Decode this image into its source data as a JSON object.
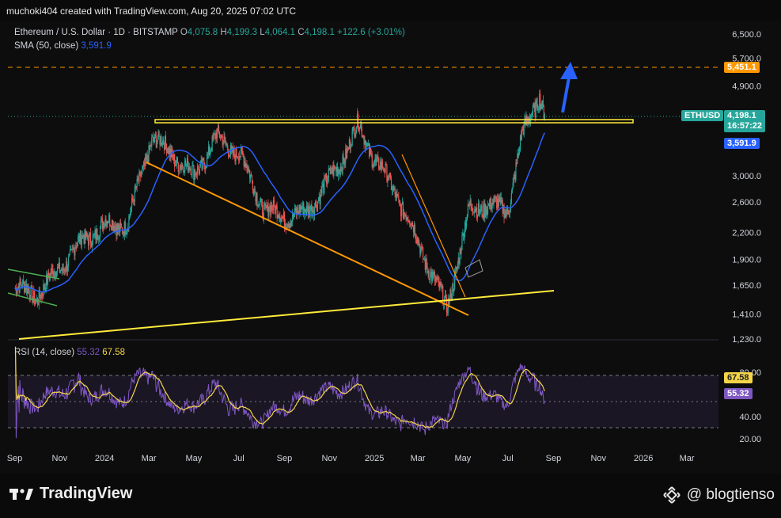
{
  "header": {
    "text": "muchoki404 created with TradingView.com, Aug 20, 2025 07:02 UTC"
  },
  "legend": {
    "symbol": "Ethereum / U.S. Dollar · 1D · BITSTAMP",
    "o_label": "O",
    "o_value": "4,075.8",
    "h_label": "H",
    "h_value": "4,199.3",
    "l_label": "L",
    "l_value": "4,064.1",
    "c_label": "C",
    "c_value": "4,198.1",
    "change": "+122.6 (+3.01%)",
    "sma_label": "SMA (50, close)",
    "sma_value": "3,591.9"
  },
  "rsi_legend": {
    "label": "RSI (14, close)",
    "value1": "55.32",
    "value2": "67.58"
  },
  "price_axis": [
    "6,500.0",
    "5,700.0",
    "4,900.0",
    "3,000.0",
    "2,600.0",
    "2,200.0",
    "1,900.0",
    "1,650.0",
    "1,410.0",
    "1,230.0"
  ],
  "rsi_axis": [
    "80.00",
    "40.00",
    "20.00"
  ],
  "badges": {
    "target": "5,451.1",
    "ticker": "ETHUSD",
    "price": "4,198.1",
    "countdown": "16:57:22",
    "sma": "3,591.9",
    "rsi1": "67.58",
    "rsi2": "55.32"
  },
  "x_axis": [
    "Sep",
    "Nov",
    "2024",
    "Mar",
    "May",
    "Jul",
    "Sep",
    "Nov",
    "2025",
    "Mar",
    "May",
    "Jul",
    "Sep",
    "Nov",
    "2026",
    "Mar"
  ],
  "footer": {
    "brand": "TradingView",
    "watermark": "@ blogtienso"
  },
  "colors": {
    "up": "#26a69a",
    "down": "#ef5350",
    "sma": "#2962ff",
    "rsi": "#7e57c2",
    "rsi_ma": "#f5d547",
    "resistance": "#ffeb3b",
    "trend_orange": "#ff9800",
    "target": "#ff9800",
    "arrow": "#2962ff"
  },
  "chart_data": {
    "type": "candlestick",
    "symbol": "Ethereum / U.S. Dollar",
    "interval": "1D",
    "exchange": "BITSTAMP",
    "y_scale": "log",
    "ylim": [
      1230,
      6500
    ],
    "x_range": [
      "2023-09",
      "2026-03"
    ],
    "last": {
      "open": 4075.8,
      "high": 4199.3,
      "low": 4064.1,
      "close": 4198.1
    },
    "approx_closes": [
      {
        "date": "2023-09-01",
        "close": 1640
      },
      {
        "date": "2023-10-01",
        "close": 1560
      },
      {
        "date": "2023-11-01",
        "close": 1810
      },
      {
        "date": "2023-12-01",
        "close": 2100
      },
      {
        "date": "2024-01-01",
        "close": 2300
      },
      {
        "date": "2024-02-01",
        "close": 2300
      },
      {
        "date": "2024-03-05",
        "close": 3700
      },
      {
        "date": "2024-04-01",
        "close": 3400
      },
      {
        "date": "2024-05-01",
        "close": 3000
      },
      {
        "date": "2024-06-01",
        "close": 3700
      },
      {
        "date": "2024-07-01",
        "close": 3400
      },
      {
        "date": "2024-08-05",
        "close": 2500
      },
      {
        "date": "2024-09-01",
        "close": 2400
      },
      {
        "date": "2024-10-01",
        "close": 2450
      },
      {
        "date": "2024-11-15",
        "close": 3200
      },
      {
        "date": "2024-12-10",
        "close": 3950
      },
      {
        "date": "2025-01-01",
        "close": 3300
      },
      {
        "date": "2025-02-01",
        "close": 2700
      },
      {
        "date": "2025-03-01",
        "close": 2100
      },
      {
        "date": "2025-04-09",
        "close": 1450
      },
      {
        "date": "2025-05-10",
        "close": 2500
      },
      {
        "date": "2025-06-01",
        "close": 2550
      },
      {
        "date": "2025-07-01",
        "close": 2500
      },
      {
        "date": "2025-07-20",
        "close": 3700
      },
      {
        "date": "2025-08-13",
        "close": 4700
      },
      {
        "date": "2025-08-20",
        "close": 4198.1
      }
    ],
    "sma50": {
      "label": "SMA (50, close)",
      "last": 3591.9
    },
    "rsi": {
      "label": "RSI (14, close)",
      "last": 55.32,
      "ma_last": 67.58,
      "ylim": [
        20,
        80
      ],
      "bands": [
        70,
        50,
        30
      ]
    },
    "annotations": [
      {
        "type": "horizontal_resistance",
        "price": 4090
      },
      {
        "type": "target_line",
        "price": 5451.1
      },
      {
        "type": "arrow_up",
        "at": "2025-08-20"
      }
    ]
  }
}
